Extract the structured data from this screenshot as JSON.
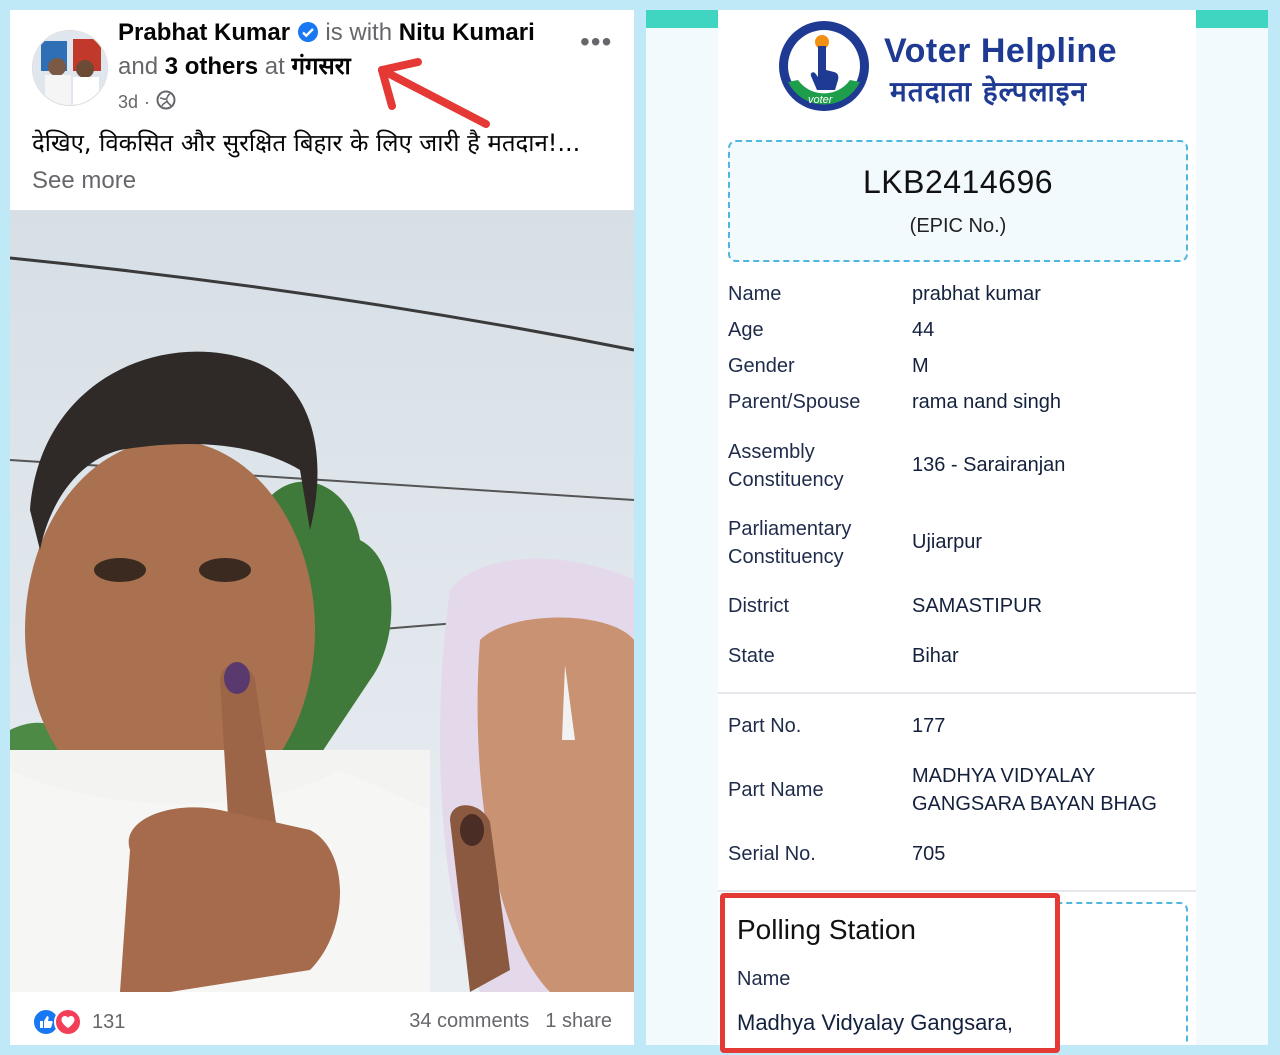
{
  "post": {
    "author": "Prabhat Kumar",
    "is_with_text": "is with",
    "tagged": "Nitu Kumari",
    "and_text": "and",
    "others": "3 others",
    "at_text": "at",
    "location": "गंगसरा",
    "time": "3d",
    "separator": "·",
    "body_text": "देखिए, विकसित और सुरक्षित बिहार के लिए जारी है मतदान!...",
    "see_more": "See more",
    "reactions_count": "131",
    "comments": "34 comments",
    "shares": "1 share",
    "colors": {
      "link_blue": "#1877f2",
      "love_red": "#f33e58",
      "arrow_red": "#e53935"
    },
    "icons": [
      "verified-badge-icon",
      "globe-icon",
      "more-options-icon",
      "like-reaction-icon",
      "love-reaction-icon",
      "annotation-arrow-icon"
    ]
  },
  "voter": {
    "app_title_en": "Voter Helpline",
    "app_title_hi": "मतदाता हेल्पलाइन",
    "logo_text": "voter",
    "epic_no": "LKB2414696",
    "epic_caption": "(EPIC No.)",
    "fields": [
      {
        "label": "Name",
        "value": "prabhat kumar"
      },
      {
        "label": "Age",
        "value": "44"
      },
      {
        "label": "Gender",
        "value": "M"
      },
      {
        "label": "Parent/Spouse",
        "value": "rama nand singh"
      },
      {
        "label": "Assembly Constituency",
        "value": "136 - Sarairanjan"
      },
      {
        "label": "Parliamentary Constituency",
        "value": "Ujiarpur"
      },
      {
        "label": "District",
        "value": "SAMASTIPUR"
      },
      {
        "label": "State",
        "value": "Bihar"
      },
      {
        "label": "Part No.",
        "value": "177"
      },
      {
        "label": "Part Name",
        "value": "MADHYA VIDYALAY GANGSARA BAYAN BHAG"
      },
      {
        "label": "Serial No.",
        "value": "705"
      }
    ],
    "polling_station": {
      "title": "Polling Station",
      "name_label": "Name",
      "name_value": "Madhya Vidyalay  Gangsara,"
    },
    "colors": {
      "brand_blue": "#1f3a93",
      "dash_blue": "#4fb6e0",
      "top_bar": "#3fd5c0",
      "highlight_red": "#e53935"
    }
  }
}
